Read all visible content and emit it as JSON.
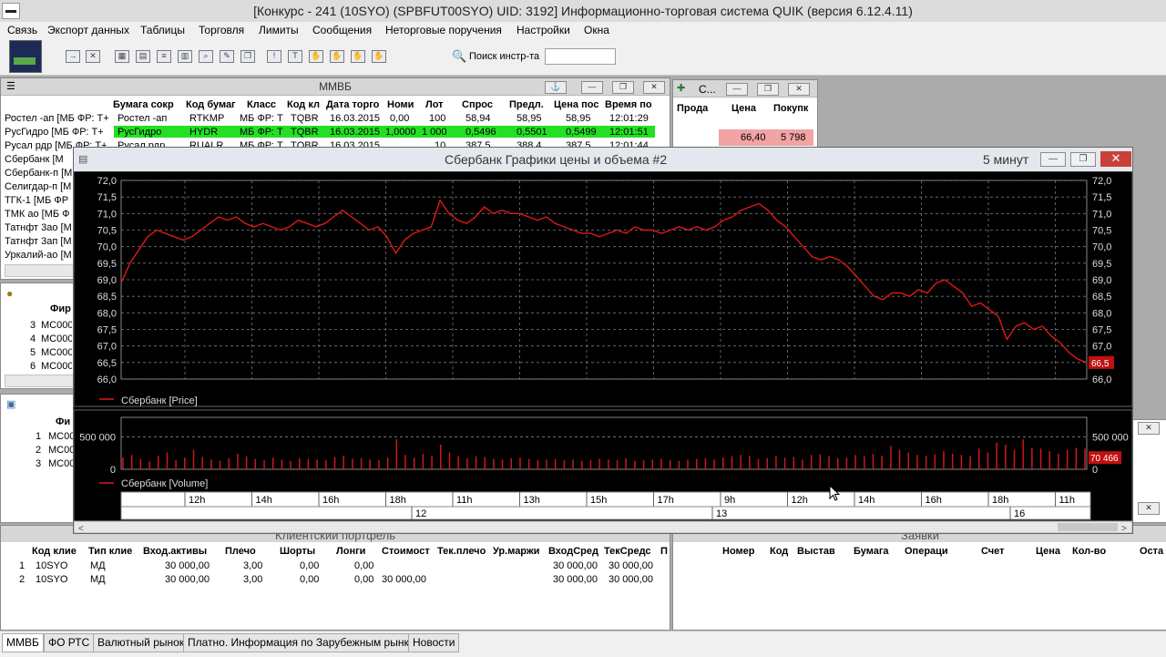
{
  "app": {
    "title": "[Конкурс - 241 (10SYO) (SPBFUT00SYO) UID: 3192] Информационно-торговая система QUIK (версия 6.12.4.11)"
  },
  "menu": [
    "Связь",
    "Экспорт данных",
    "Таблицы",
    "Торговля",
    "Лимиты",
    "Сообщения",
    "Неторговые поручения",
    "Настройки",
    "Окна"
  ],
  "toolbar": {
    "search_label": "Поиск инстр-та",
    "search_value": ""
  },
  "mmvb": {
    "title": "ММВБ",
    "columns": [
      "Бумага сокр",
      "Код бумаг",
      "Класс",
      "Код кл",
      "Дата торго",
      "Номи",
      "Лот",
      "Спрос",
      "Предл.",
      "Цена пос",
      "Время по"
    ],
    "rows": [
      {
        "name": "Ростел -ап [МБ ФР: Т+",
        "short": "Ростел -ап",
        "code": "RTKMP",
        "class": "МБ ФР: Т",
        "cl": "TQBR",
        "date": "16.03.2015",
        "nom": "0,00",
        "lot": "100",
        "bid": "58,94",
        "ask": "58,95",
        "last": "58,95",
        "time": "12:01:29"
      },
      {
        "name": "РусГидро [МБ ФР: Т+",
        "short": "РусГидро",
        "code": "HYDR",
        "class": "МБ ФР: Т",
        "cl": "TQBR",
        "date": "16.03.2015",
        "nom": "1,0000",
        "lot": "1 000",
        "bid": "0,5496",
        "ask": "0,5501",
        "last": "0,5499",
        "time": "12:01:51"
      },
      {
        "name": "Русал рдр [МБ ФР: Т+",
        "short": "Русал рдр",
        "code": "RUALR",
        "class": "МБ ФР: Т",
        "cl": "TQBR",
        "date": "16.03.2015",
        "nom": "",
        "lot": "10",
        "bid": "387,5",
        "ask": "388,4",
        "last": "387,5",
        "time": "12:01:44"
      }
    ],
    "left_names": [
      "Сбербанк [М",
      "Сбербанк-п [М",
      "Селигдар-п [М",
      "ТГК-1 [МБ ФР",
      "ТМК ао [МБ Ф",
      "Татнфт 3ао [М",
      "Татнфт 3ап [М",
      "Уркалий-ао [М"
    ]
  },
  "cwin": {
    "title": "С...",
    "columns": [
      "Прода",
      "Цена",
      "Покупк"
    ],
    "price": "66,40",
    "buy": "5 798"
  },
  "firm1": {
    "header": "Фир",
    "rows": [
      {
        "n": "3",
        "v": "MC000"
      },
      {
        "n": "4",
        "v": "MC000"
      },
      {
        "n": "5",
        "v": "MC000"
      },
      {
        "n": "6",
        "v": "MC000"
      }
    ]
  },
  "firm2": {
    "header": "Фи",
    "rows": [
      {
        "n": "1",
        "v": "MC00"
      },
      {
        "n": "2",
        "v": "MC00"
      },
      {
        "n": "3",
        "v": "MC00"
      }
    ]
  },
  "chart_window": {
    "title": "Сбербанк Графики цены и объема #2",
    "interval": "5 минут"
  },
  "chart_data": {
    "type": "line",
    "price_series": "Сбербанк [Price]",
    "volume_series": "Сбербанк [Volume]",
    "price_ylim": [
      66.0,
      72.0
    ],
    "price_ticks": [
      "72,0",
      "71,5",
      "71,0",
      "70,5",
      "70,0",
      "69,5",
      "69,0",
      "68,5",
      "68,0",
      "67,5",
      "67,0",
      "66,5",
      "66,0"
    ],
    "last_price_label": "66,5",
    "volume_ticks": [
      "500 000",
      "0"
    ],
    "last_volume_label": "70 466",
    "time_ticks": [
      "12h",
      "14h",
      "16h",
      "18h",
      "11h",
      "13h",
      "15h",
      "17h",
      "9h",
      "12h",
      "14h",
      "16h",
      "18h",
      "11h"
    ],
    "day_labels": [
      "12",
      "13",
      "16"
    ],
    "price_points": [
      [
        0,
        68.9
      ],
      [
        1,
        69.5
      ],
      [
        2,
        69.9
      ],
      [
        3,
        70.3
      ],
      [
        4,
        70.5
      ],
      [
        5,
        70.4
      ],
      [
        6,
        70.3
      ],
      [
        7,
        70.2
      ],
      [
        8,
        70.3
      ],
      [
        9,
        70.5
      ],
      [
        10,
        70.7
      ],
      [
        11,
        70.9
      ],
      [
        12,
        70.8
      ],
      [
        13,
        70.9
      ],
      [
        14,
        70.7
      ],
      [
        15,
        70.6
      ],
      [
        16,
        70.7
      ],
      [
        17,
        70.6
      ],
      [
        18,
        70.5
      ],
      [
        19,
        70.6
      ],
      [
        20,
        70.8
      ],
      [
        21,
        70.7
      ],
      [
        22,
        70.6
      ],
      [
        23,
        70.7
      ],
      [
        24,
        70.9
      ],
      [
        25,
        71.1
      ],
      [
        26,
        70.9
      ],
      [
        27,
        70.7
      ],
      [
        28,
        70.5
      ],
      [
        29,
        70.6
      ],
      [
        30,
        70.3
      ],
      [
        31,
        69.8
      ],
      [
        32,
        70.2
      ],
      [
        33,
        70.4
      ],
      [
        34,
        70.5
      ],
      [
        35,
        70.6
      ],
      [
        36,
        71.4
      ],
      [
        37,
        71.0
      ],
      [
        38,
        70.8
      ],
      [
        39,
        70.7
      ],
      [
        40,
        70.9
      ],
      [
        41,
        71.2
      ],
      [
        42,
        71.0
      ],
      [
        43,
        71.1
      ],
      [
        44,
        71.0
      ],
      [
        45,
        71.0
      ],
      [
        46,
        70.9
      ],
      [
        47,
        70.8
      ],
      [
        48,
        70.9
      ],
      [
        49,
        70.7
      ],
      [
        50,
        70.6
      ],
      [
        51,
        70.5
      ],
      [
        52,
        70.4
      ],
      [
        53,
        70.4
      ],
      [
        54,
        70.3
      ],
      [
        55,
        70.4
      ],
      [
        56,
        70.5
      ],
      [
        57,
        70.4
      ],
      [
        58,
        70.6
      ],
      [
        59,
        70.5
      ],
      [
        60,
        70.5
      ],
      [
        61,
        70.4
      ],
      [
        62,
        70.5
      ],
      [
        63,
        70.6
      ],
      [
        64,
        70.5
      ],
      [
        65,
        70.6
      ],
      [
        66,
        70.5
      ],
      [
        67,
        70.6
      ],
      [
        68,
        70.8
      ],
      [
        69,
        70.9
      ],
      [
        70,
        71.1
      ],
      [
        71,
        71.2
      ],
      [
        72,
        71.3
      ],
      [
        73,
        71.1
      ],
      [
        74,
        70.8
      ],
      [
        75,
        70.6
      ],
      [
        76,
        70.3
      ],
      [
        77,
        70.0
      ],
      [
        78,
        69.7
      ],
      [
        79,
        69.6
      ],
      [
        80,
        69.7
      ],
      [
        81,
        69.6
      ],
      [
        82,
        69.4
      ],
      [
        83,
        69.1
      ],
      [
        84,
        68.8
      ],
      [
        85,
        68.5
      ],
      [
        86,
        68.4
      ],
      [
        87,
        68.6
      ],
      [
        88,
        68.6
      ],
      [
        89,
        68.5
      ],
      [
        90,
        68.7
      ],
      [
        91,
        68.6
      ],
      [
        92,
        68.9
      ],
      [
        93,
        69.0
      ],
      [
        94,
        68.8
      ],
      [
        95,
        68.6
      ],
      [
        96,
        68.2
      ],
      [
        97,
        68.3
      ],
      [
        98,
        68.1
      ],
      [
        99,
        67.9
      ],
      [
        100,
        67.2
      ],
      [
        101,
        67.6
      ],
      [
        102,
        67.7
      ],
      [
        103,
        67.5
      ],
      [
        104,
        67.6
      ],
      [
        105,
        67.3
      ],
      [
        106,
        67.1
      ],
      [
        107,
        66.8
      ],
      [
        108,
        66.6
      ],
      [
        109,
        66.5
      ]
    ],
    "volume_bars": [
      180,
      220,
      160,
      120,
      210,
      260,
      140,
      180,
      300,
      190,
      150,
      130,
      170,
      240,
      200,
      160,
      140,
      180,
      150,
      130,
      170,
      160,
      150,
      140,
      190,
      210,
      160,
      170,
      150,
      140,
      180,
      460,
      220,
      180,
      240,
      200,
      380,
      260,
      200,
      170,
      200,
      190,
      160,
      150,
      170,
      180,
      160,
      140,
      150,
      160,
      140,
      150,
      130,
      140,
      160,
      150,
      140,
      170,
      130,
      140,
      150,
      160,
      140,
      130,
      150,
      160,
      170,
      150,
      180,
      200,
      220,
      210,
      160,
      170,
      200,
      180,
      190,
      150,
      220,
      230,
      200,
      170,
      180,
      220,
      200,
      240,
      210,
      360,
      300,
      260,
      220,
      210,
      230,
      280,
      240,
      220,
      200,
      320,
      260,
      410,
      380,
      300,
      460,
      330,
      320,
      280,
      240,
      300,
      330,
      320
    ]
  },
  "portfolio": {
    "title": "Клиентский портфель",
    "columns": [
      "Код клие",
      "Тип клие",
      "Вход.активы",
      "Плечо",
      "Шорты",
      "Лонги",
      "Стоимост",
      "Тек.плечо",
      "Ур.маржи",
      "ВходСред",
      "ТекСредс",
      "П"
    ],
    "rows": [
      {
        "n": "1",
        "code": "10SYO",
        "type": "МД",
        "in": "30 000,00",
        "lev": "3,00",
        "shorts": "0,00",
        "longs": "0,00",
        "cost": "",
        "curlev": "",
        "margin": "",
        "insr": "30 000,00",
        "cursr": "30 000,00"
      },
      {
        "n": "2",
        "code": "10SYO",
        "type": "МД",
        "in": "30 000,00",
        "lev": "3,00",
        "shorts": "0,00",
        "longs": "0,00",
        "cost": "30 000,00",
        "curlev": "",
        "margin": "",
        "insr": "30 000,00",
        "cursr": "30 000,00"
      }
    ]
  },
  "orders": {
    "title": "Заявки",
    "columns": [
      "Номер",
      "Код",
      "Выстав",
      "Бумага",
      "Операци",
      "Счет",
      "Цена",
      "Кол-во",
      "Оста"
    ]
  },
  "tabs": [
    "ММВБ",
    "ФО РТС",
    "Валютный рынок",
    "Платно. Информация по Зарубежным рынкам",
    "Новости"
  ]
}
